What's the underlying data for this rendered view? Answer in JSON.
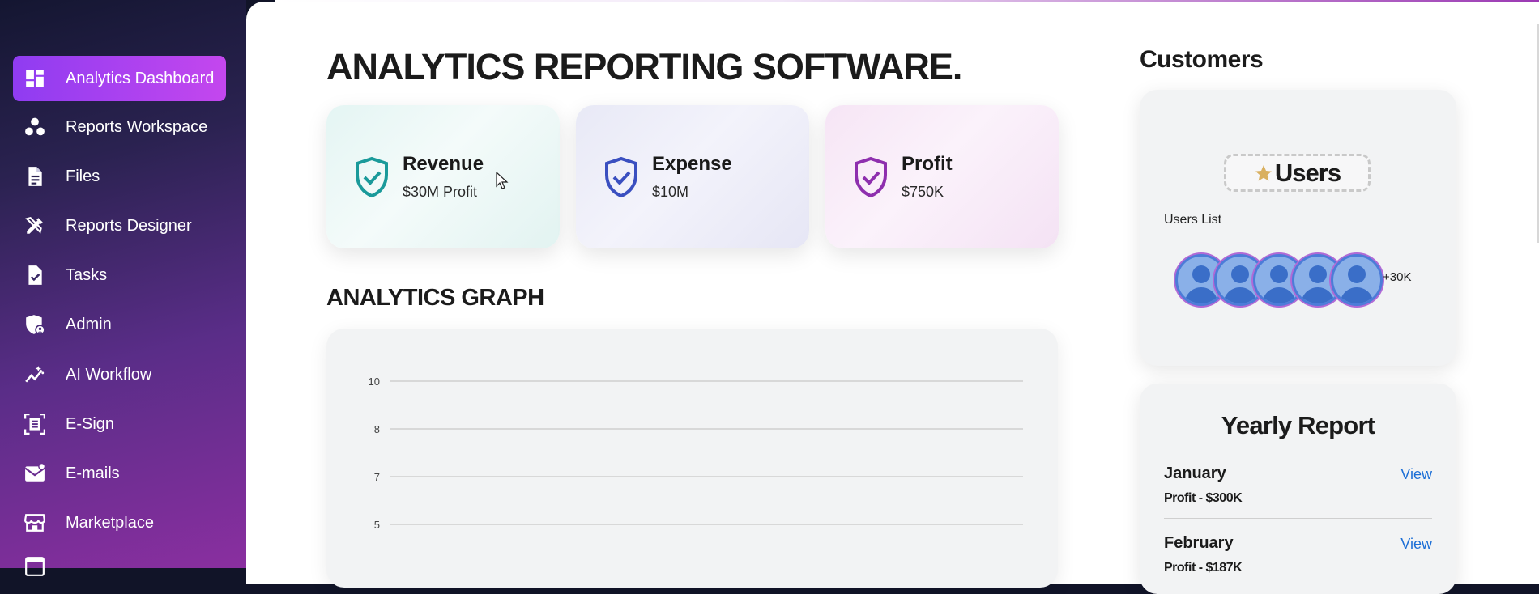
{
  "sidebar": {
    "items": [
      {
        "label": "Analytics Dashboard",
        "icon": "dashboard-icon",
        "active": true
      },
      {
        "label": "Reports Workspace",
        "icon": "workspace-icon"
      },
      {
        "label": "Files",
        "icon": "file-icon"
      },
      {
        "label": "Reports Designer",
        "icon": "designer-icon"
      },
      {
        "label": "Tasks",
        "icon": "task-icon"
      },
      {
        "label": "Admin",
        "icon": "admin-shield-icon"
      },
      {
        "label": "AI Workflow",
        "icon": "ai-workflow-icon"
      },
      {
        "label": "E-Sign",
        "icon": "esign-icon"
      },
      {
        "label": "E-mails",
        "icon": "email-icon"
      },
      {
        "label": "Marketplace",
        "icon": "marketplace-icon"
      }
    ]
  },
  "main": {
    "title": "ANALYTICS REPORTING SOFTWARE.",
    "cards": [
      {
        "title": "Revenue",
        "value": "$30M Profit",
        "color": "#1a9a9a"
      },
      {
        "title": "Expense",
        "value": "$10M",
        "color": "#3a4fc0"
      },
      {
        "title": "Profit",
        "value": "$750K",
        "color": "#8e2fae"
      }
    ],
    "graph_title": "ANALYTICS GRAPH"
  },
  "chart_data": {
    "type": "line",
    "y_ticks": [
      "10",
      "8",
      "7",
      "5"
    ],
    "grid": true
  },
  "customers": {
    "title": "Customers",
    "badge": "Users",
    "list_label": "Users List",
    "extra_count": "+30K"
  },
  "yearly": {
    "title": "Yearly Report",
    "rows": [
      {
        "month": "January",
        "profit": "Profit - $300K",
        "link": "View"
      },
      {
        "month": "February",
        "profit": "Profit - $187K",
        "link": "View"
      }
    ]
  },
  "colors": {
    "accent": "#a040f0",
    "link": "#1d6fd6"
  }
}
